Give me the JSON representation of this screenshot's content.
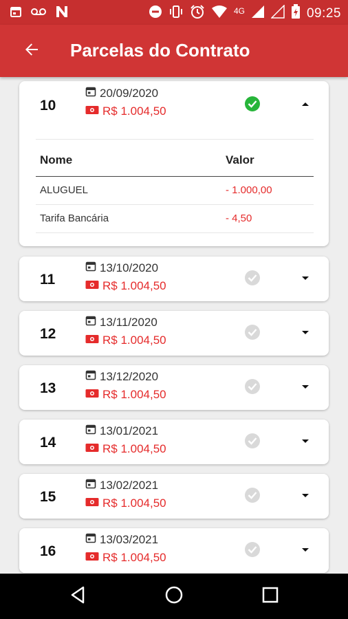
{
  "status_bar": {
    "time": "09:25",
    "network": "4G",
    "left_icons": [
      "calendar-icon",
      "voicemail-icon",
      "n-app-icon"
    ],
    "right_icons": [
      "do-not-disturb-icon",
      "vibrate-icon",
      "alarm-icon",
      "wifi-icon",
      "signal-icon",
      "signal-empty-icon",
      "battery-icon"
    ]
  },
  "app_bar": {
    "title": "Parcelas do Contrato",
    "back_icon": "arrow-back-icon",
    "color": "#d03535"
  },
  "installments": [
    {
      "number": "10",
      "date": "20/09/2020",
      "value": "R$ 1.004,50",
      "paid": true,
      "expanded": true,
      "detail": {
        "col_name": "Nome",
        "col_value": "Valor",
        "rows": [
          {
            "name": "ALUGUEL",
            "value": "- 1.000,00"
          },
          {
            "name": "Tarifa Bancária",
            "value": "- 4,50"
          }
        ]
      }
    },
    {
      "number": "11",
      "date": "13/10/2020",
      "value": "R$ 1.004,50",
      "paid": false,
      "expanded": false
    },
    {
      "number": "12",
      "date": "13/11/2020",
      "value": "R$ 1.004,50",
      "paid": false,
      "expanded": false
    },
    {
      "number": "13",
      "date": "13/12/2020",
      "value": "R$ 1.004,50",
      "paid": false,
      "expanded": false
    },
    {
      "number": "14",
      "date": "13/01/2021",
      "value": "R$ 1.004,50",
      "paid": false,
      "expanded": false
    },
    {
      "number": "15",
      "date": "13/02/2021",
      "value": "R$ 1.004,50",
      "paid": false,
      "expanded": false
    },
    {
      "number": "16",
      "date": "13/03/2021",
      "value": "R$ 1.004,50",
      "paid": false,
      "expanded": false
    }
  ],
  "colors": {
    "brand": "#d03535",
    "value_red": "#e52b2b",
    "paid_green": "#27b53a",
    "pending_grey": "#d9d9d9"
  },
  "nav_bar": {
    "icons": [
      "nav-back-icon",
      "nav-home-icon",
      "nav-recents-icon"
    ]
  }
}
